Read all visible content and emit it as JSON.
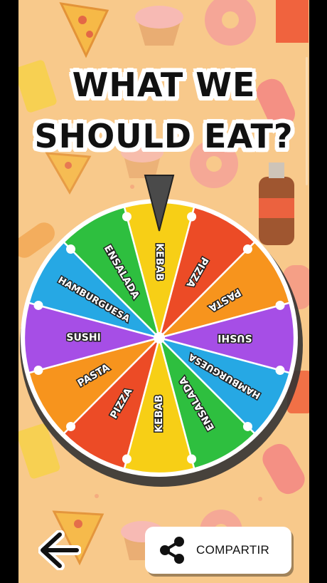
{
  "title": {
    "line1": "WHAT WE",
    "line2": "SHOULD EAT?"
  },
  "wheel": {
    "segments": [
      {
        "label": "KEBAB",
        "color": "#f7cf16"
      },
      {
        "label": "PIZZA",
        "color": "#ec4b26"
      },
      {
        "label": "PASTA",
        "color": "#f7941d"
      },
      {
        "label": "SUSHI",
        "color": "#a64ee6"
      },
      {
        "label": "HAMBURGUESA",
        "color": "#26a8e4"
      },
      {
        "label": "ENSALADA",
        "color": "#2ebf3f"
      },
      {
        "label": "KEBAB",
        "color": "#f7cf16"
      },
      {
        "label": "PIZZA",
        "color": "#ec4b26"
      },
      {
        "label": "PASTA",
        "color": "#f7941d"
      },
      {
        "label": "SUSHI",
        "color": "#a64ee6"
      },
      {
        "label": "HAMBURGUESA",
        "color": "#26a8e4"
      },
      {
        "label": "ENSALADA",
        "color": "#2ebf3f"
      }
    ]
  },
  "share": {
    "label": "COMPARTIR"
  },
  "colors": {
    "background": "#f8c98b",
    "pointer": "#4a4a4a"
  }
}
